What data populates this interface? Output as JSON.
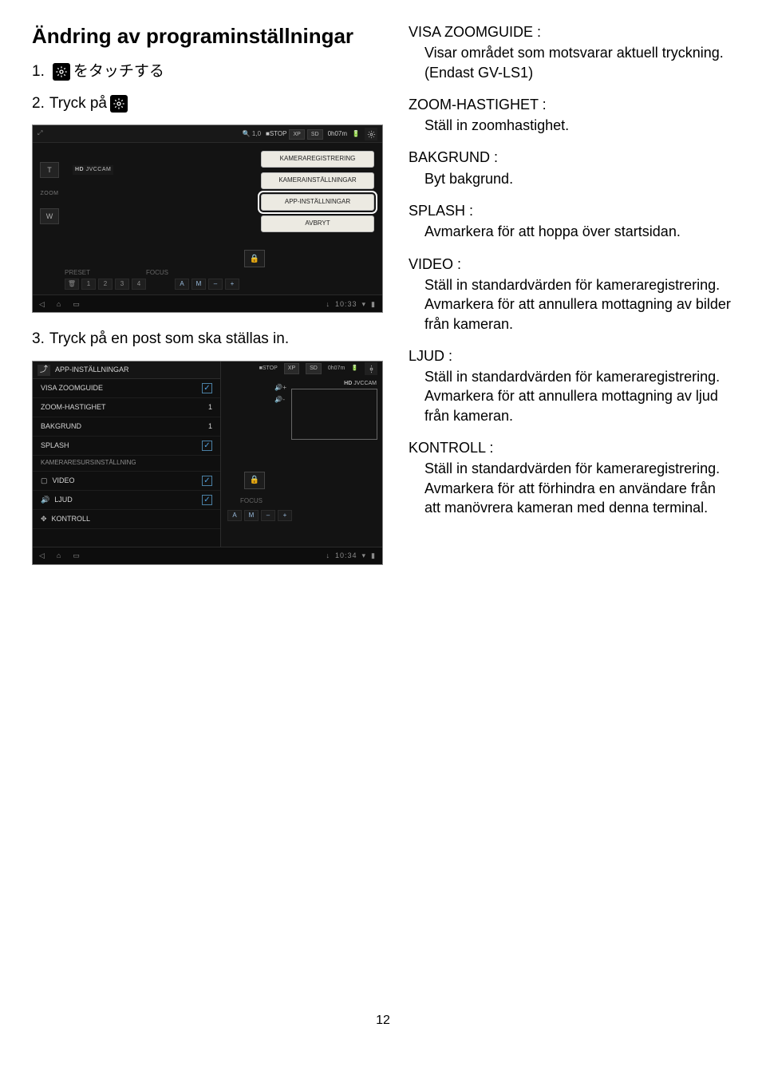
{
  "title": "Ändring av programinställningar",
  "step1": {
    "num": "1.",
    "text_after": " をタッチする"
  },
  "step2": {
    "num": "2.",
    "text_before": "Tryck på "
  },
  "step3": {
    "num": "3.",
    "text": "Tryck på en post som ska ställas in."
  },
  "page_num": "12",
  "ui": {
    "zoom_t": "T",
    "zoom_w": "W",
    "zoom_label": "ZOOM",
    "zoom_val": "1,0",
    "stop": "■STOP",
    "xp": "XP",
    "sd": "SD",
    "time": "0h07m",
    "jvccam_hd": "HD",
    "jvccam": "JVCCAM",
    "menu1": "KAMERAREGISTRERING",
    "menu2": "KAMERAINSTÄLLNINGAR",
    "menu3": "APP-INSTÄLLNINGAR",
    "menu4": "AVBRYT",
    "preset": "PRESET",
    "focus": "FOCUS",
    "p1": "1",
    "p2": "2",
    "p3": "3",
    "p4": "4",
    "a": "A",
    "m": "M",
    "minus": "–",
    "plus": "+",
    "clock1": "10:33",
    "clock2": "10:34",
    "sp_header": "APP-INSTÄLLNINGAR",
    "row1": "VISA ZOOMGUIDE",
    "row2": "ZOOM-HASTIGHET",
    "row2v": "1",
    "row3": "BAKGRUND",
    "row3v": "1",
    "row4": "SPLASH",
    "row5": "KAMERARESURSINSTÄLLNING",
    "row6": "VIDEO",
    "row7": "LJUD",
    "row8": "KONTROLL"
  },
  "defs": {
    "d1t": "VISA ZOOMGUIDE :",
    "d1a": "Visar området som motsvarar aktuell tryckning.",
    "d1b": "(Endast GV-LS1)",
    "d2t": "ZOOM-HASTIGHET :",
    "d2a": "Ställ in zoomhastighet.",
    "d3t": "BAKGRUND :",
    "d3a": "Byt bakgrund.",
    "d4t": "SPLASH :",
    "d4a": "Avmarkera för att hoppa över startsidan.",
    "d5t": "VIDEO :",
    "d5a": "Ställ in standardvärden för kameraregistrering.",
    "d5b": "Avmarkera för att annullera mottagning av bilder från kameran.",
    "d6t": "LJUD :",
    "d6a": "Ställ in standardvärden för kameraregistrering.",
    "d6b": "Avmarkera för att annullera mottagning av ljud från kameran.",
    "d7t": "KONTROLL :",
    "d7a": "Ställ in standardvärden för kameraregistrering.",
    "d7b": "Avmarkera för att förhindra en användare från att manövrera kameran med denna terminal."
  }
}
